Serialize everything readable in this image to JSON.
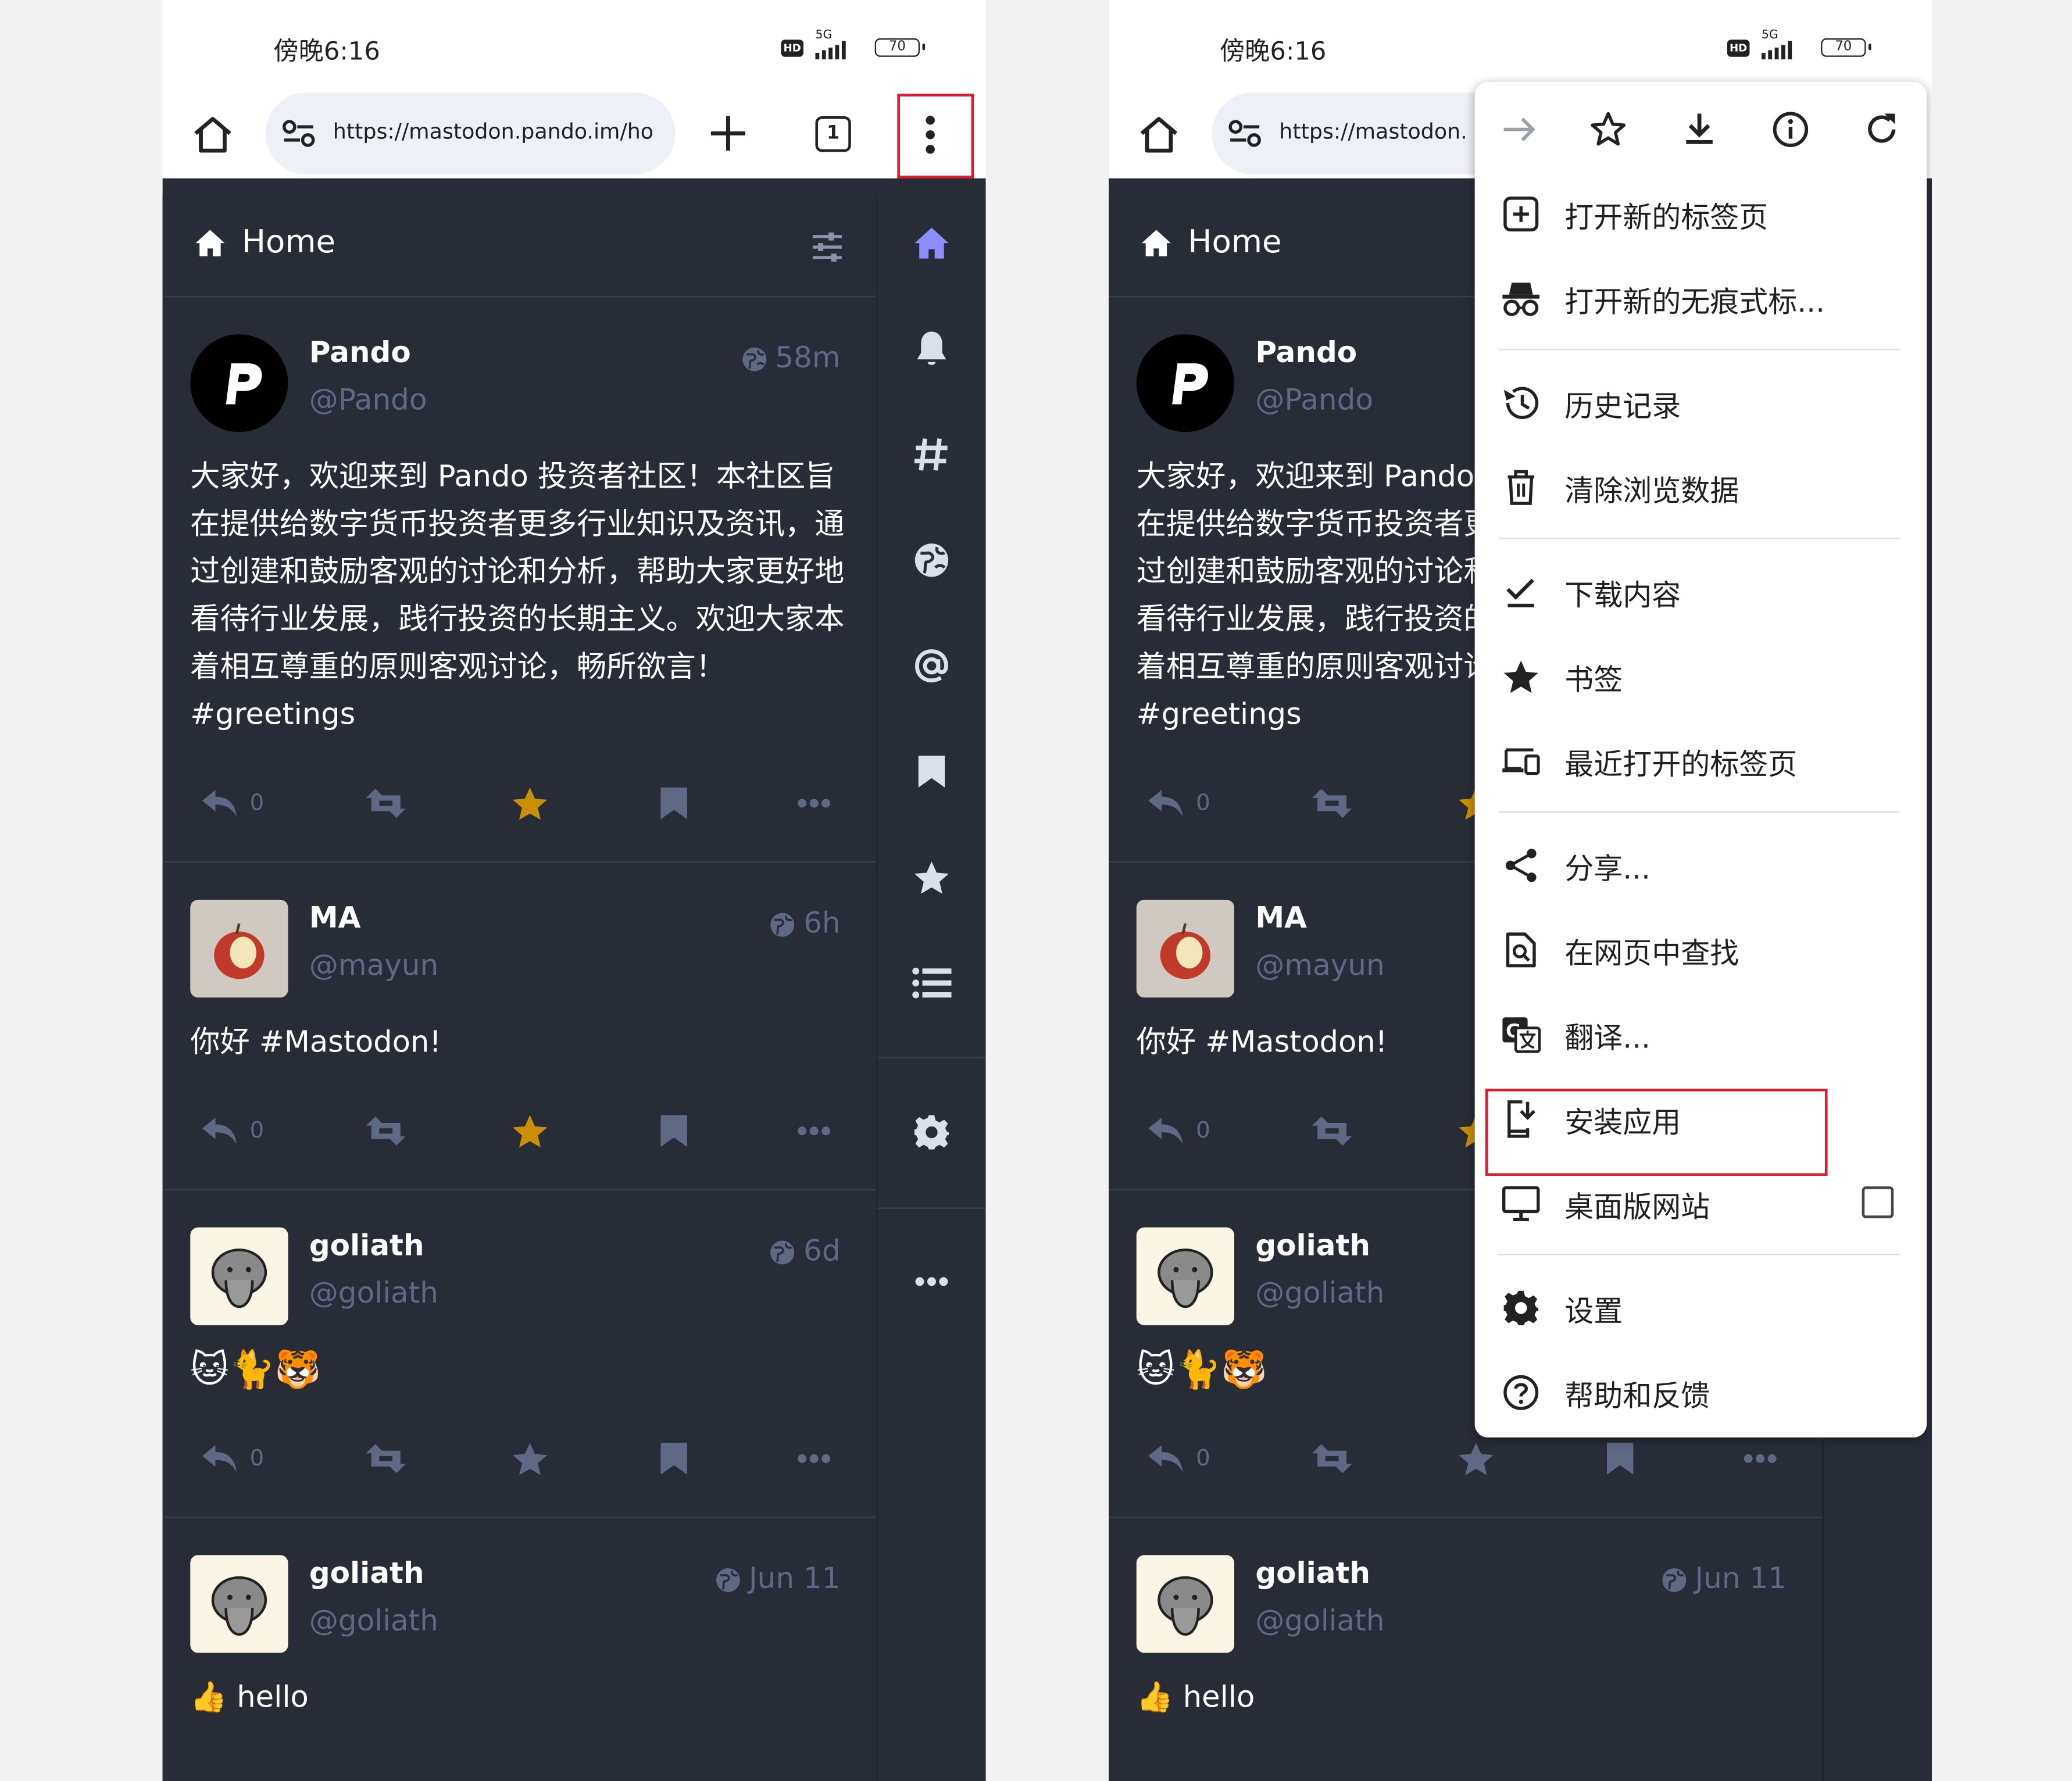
{
  "status_bar": {
    "time": "傍晚6:16",
    "hd": "HD",
    "network": "5G",
    "battery": "70"
  },
  "browser": {
    "url_left": "https://mastodon.pando.im/ho",
    "url_right": "https://mastodon.",
    "tab_count": "1"
  },
  "column": {
    "title": "Home"
  },
  "posts": [
    {
      "name": "Pando",
      "handle": "@Pando",
      "time": "58m",
      "body_left": "大家好，欢迎来到 Pando 投资者社区！本社区旨在提供给数字货币投资者更多行业知识及资讯，通过创建和鼓励客观的讨论和分析，帮助大家更好地看待行业发展，践行投资的长期主义。欢迎大家本着相互尊重的原则客观讨论，畅所欲言！ #greetings",
      "body_right": "大家好，欢迎来到 Pando 投资者社区！本社区旨在提供给数字货币投资者更多行业知识及资讯，通过创建和鼓励客观的讨论和分析，帮助大家更好地看待行业发展，践行投资的长期主义。欢迎大家本着相互尊重的原则客观讨论，畅所欲言！ #greetings",
      "reply_count": "0",
      "favourited": true
    },
    {
      "name": "MA",
      "handle": "@mayun",
      "time": "6h",
      "body_left": "你好 #Mastodon!",
      "body_right": "你好 #Mastodon!",
      "reply_count": "0",
      "favourited": true
    },
    {
      "name": "goliath",
      "handle": "@goliath",
      "time": "6d",
      "body_left": "🐱🐈🐯",
      "body_right": "🐱🐈🐯",
      "reply_count": "0",
      "favourited": false
    },
    {
      "name": "goliath",
      "handle": "@goliath",
      "time": "Jun 11",
      "body_left": "👍 hello",
      "body_right": "👍 hello",
      "reply_count": "0",
      "favourited": false
    }
  ],
  "menu": {
    "items": [
      {
        "label": "打开新的标签页",
        "icon": "new-tab-icon"
      },
      {
        "label": "打开新的无痕式标...",
        "icon": "incognito-icon"
      },
      {
        "label": "历史记录",
        "icon": "history-icon"
      },
      {
        "label": "清除浏览数据",
        "icon": "trash-icon"
      },
      {
        "label": "下载内容",
        "icon": "downloads-icon"
      },
      {
        "label": "书签",
        "icon": "bookmark-star-icon"
      },
      {
        "label": "最近打开的标签页",
        "icon": "devices-icon"
      },
      {
        "label": "分享...",
        "icon": "share-icon"
      },
      {
        "label": "在网页中查找",
        "icon": "find-in-page-icon"
      },
      {
        "label": "翻译...",
        "icon": "translate-icon"
      },
      {
        "label": "安装应用",
        "icon": "install-app-icon"
      },
      {
        "label": "桌面版网站",
        "icon": "desktop-icon"
      },
      {
        "label": "设置",
        "icon": "settings-gear-icon"
      },
      {
        "label": "帮助和反馈",
        "icon": "help-icon"
      }
    ]
  },
  "colors": {
    "app_bg": "#282c37",
    "muted": "#606984",
    "accent": "#8c8dff",
    "star": "#ca8f04",
    "highlight": "#e0192e"
  }
}
